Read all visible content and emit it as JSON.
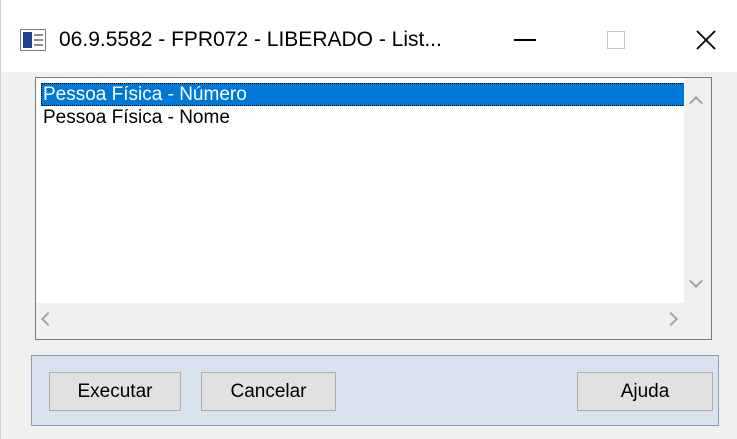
{
  "window": {
    "title": "06.9.5582 - FPR072 - LIBERADO - List..."
  },
  "list": {
    "items": [
      {
        "label": "Pessoa Física - Número",
        "selected": true
      },
      {
        "label": "Pessoa Física - Nome",
        "selected": false
      }
    ]
  },
  "buttons": {
    "execute": "Executar",
    "cancel": "Cancelar",
    "help": "Ajuda"
  },
  "colors": {
    "selection": "#0078d7",
    "panel": "#d9e2ef"
  }
}
